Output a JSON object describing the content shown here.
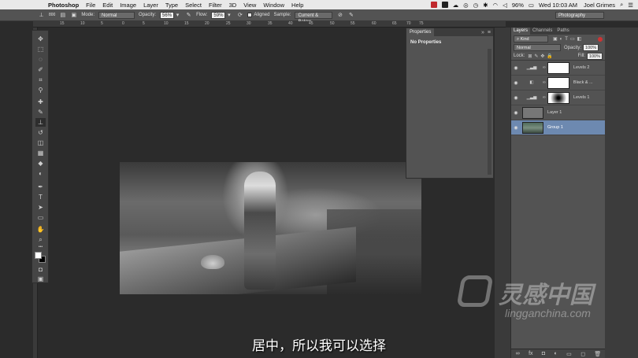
{
  "menubar": {
    "app": "Photoshop",
    "items": [
      "File",
      "Edit",
      "Image",
      "Layer",
      "Type",
      "Select",
      "Filter",
      "3D",
      "View",
      "Window",
      "Help"
    ],
    "battery": "96%",
    "clock": "Wed 10:03 AM",
    "user": "Joel Grimes"
  },
  "options": {
    "brush_size": "800",
    "mode_label": "Mode:",
    "mode_value": "Normal",
    "opacity_label": "Opacity:",
    "opacity_value": "56%",
    "flow_label": "Flow:",
    "flow_value": "59%",
    "aligned_label": "Aligned",
    "sample_label": "Sample:",
    "sample_value": "Current & Below",
    "workspace": "Photography"
  },
  "ruler": {
    "ticks": [
      "15",
      "10",
      "5",
      "0",
      "5",
      "10",
      "15",
      "20",
      "25",
      "30",
      "35",
      "40",
      "45",
      "50",
      "55",
      "60",
      "65",
      "70",
      "75"
    ]
  },
  "properties": {
    "tab": "Properties",
    "message": "No Properties"
  },
  "layers_panel": {
    "tabs": [
      "Layers",
      "Channels",
      "Paths"
    ],
    "filter": "Kind",
    "blend_mode": "Normal",
    "opacity_label": "Opacity:",
    "opacity_value": "100%",
    "lock_label": "Lock:",
    "fill_label": "Fill:",
    "fill_value": "100%",
    "layers": [
      {
        "name": "Levels 2",
        "type": "adjustment"
      },
      {
        "name": "Black & ...",
        "type": "adjustment"
      },
      {
        "name": "Levels 1",
        "type": "adjustment"
      },
      {
        "name": "Layer 1",
        "type": "pixel"
      },
      {
        "name": "Group 1",
        "type": "group",
        "selected": true
      }
    ]
  },
  "subtitle": "居中，所以我可以选择",
  "watermark": {
    "cn": "灵感中国",
    "en": "lingganchina.com"
  },
  "colors": {
    "selected_layer": "#6d89b0",
    "panel_bg": "#535353",
    "canvas_bg": "#2b2b2b"
  }
}
